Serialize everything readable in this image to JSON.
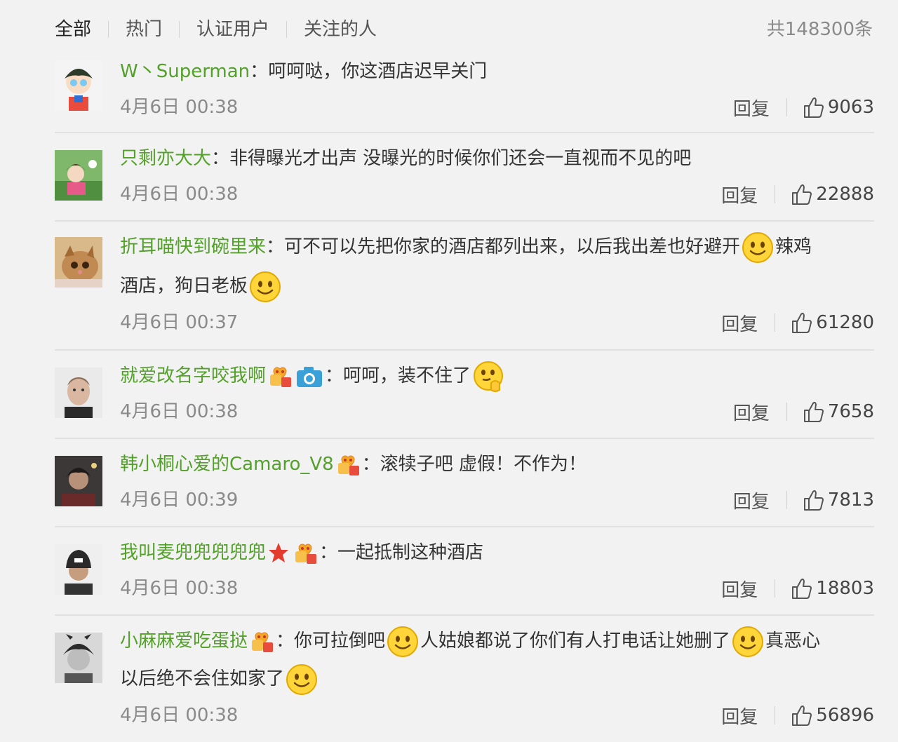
{
  "tabs": [
    "全部",
    "热门",
    "认证用户",
    "关注的人"
  ],
  "total": "共148300条",
  "reply_label": "回复",
  "comments": [
    {
      "user": "W丶Superman",
      "line1": "呵呵哒，你这酒店迟早关门",
      "time": "4月6日 00:38",
      "likes": "9063"
    },
    {
      "user": "只剩亦大大",
      "line1": "非得曝光才出声 没曝光的时候你们还会一直视而不见的吧",
      "time": "4月6日 00:38",
      "likes": "22888"
    },
    {
      "user": "折耳喵快到碗里来",
      "line1_a": "可不可以先把你家的酒店都列出来，以后我出差也好避开",
      "line1_b": "辣鸡",
      "line2": "酒店，狗日老板",
      "time": "4月6日 00:37",
      "likes": "61280"
    },
    {
      "user": "就爱改名字咬我啊",
      "line1": "呵呵，装不住了",
      "time": "4月6日 00:38",
      "likes": "7658"
    },
    {
      "user": "韩小桐心爱的Camaro_V8",
      "line1": "滚犊子吧 虚假！不作为！",
      "time": "4月6日 00:39",
      "likes": "7813"
    },
    {
      "user": "我叫麦兜兜兜兜兜",
      "line1": "一起抵制这种酒店",
      "time": "4月6日 00:38",
      "likes": "18803"
    },
    {
      "user": "小麻麻爱吃蛋挞",
      "line1_a": "你可拉倒吧",
      "line1_b": "人姑娘都说了你们有人打电话让她删了",
      "line1_c": "真恶心",
      "line2": "以后绝不会住如家了",
      "time": "4月6日 00:38",
      "likes": "56896"
    }
  ],
  "badges": {
    "fan_level_1": "1",
    "fan_level_4": "4",
    "fan_level_5": "5"
  },
  "colors": {
    "username": "#53a02a",
    "text": "#333333",
    "meta": "#8a8a8a",
    "divider": "#e1e1e1",
    "background": "#f2f2f2"
  }
}
